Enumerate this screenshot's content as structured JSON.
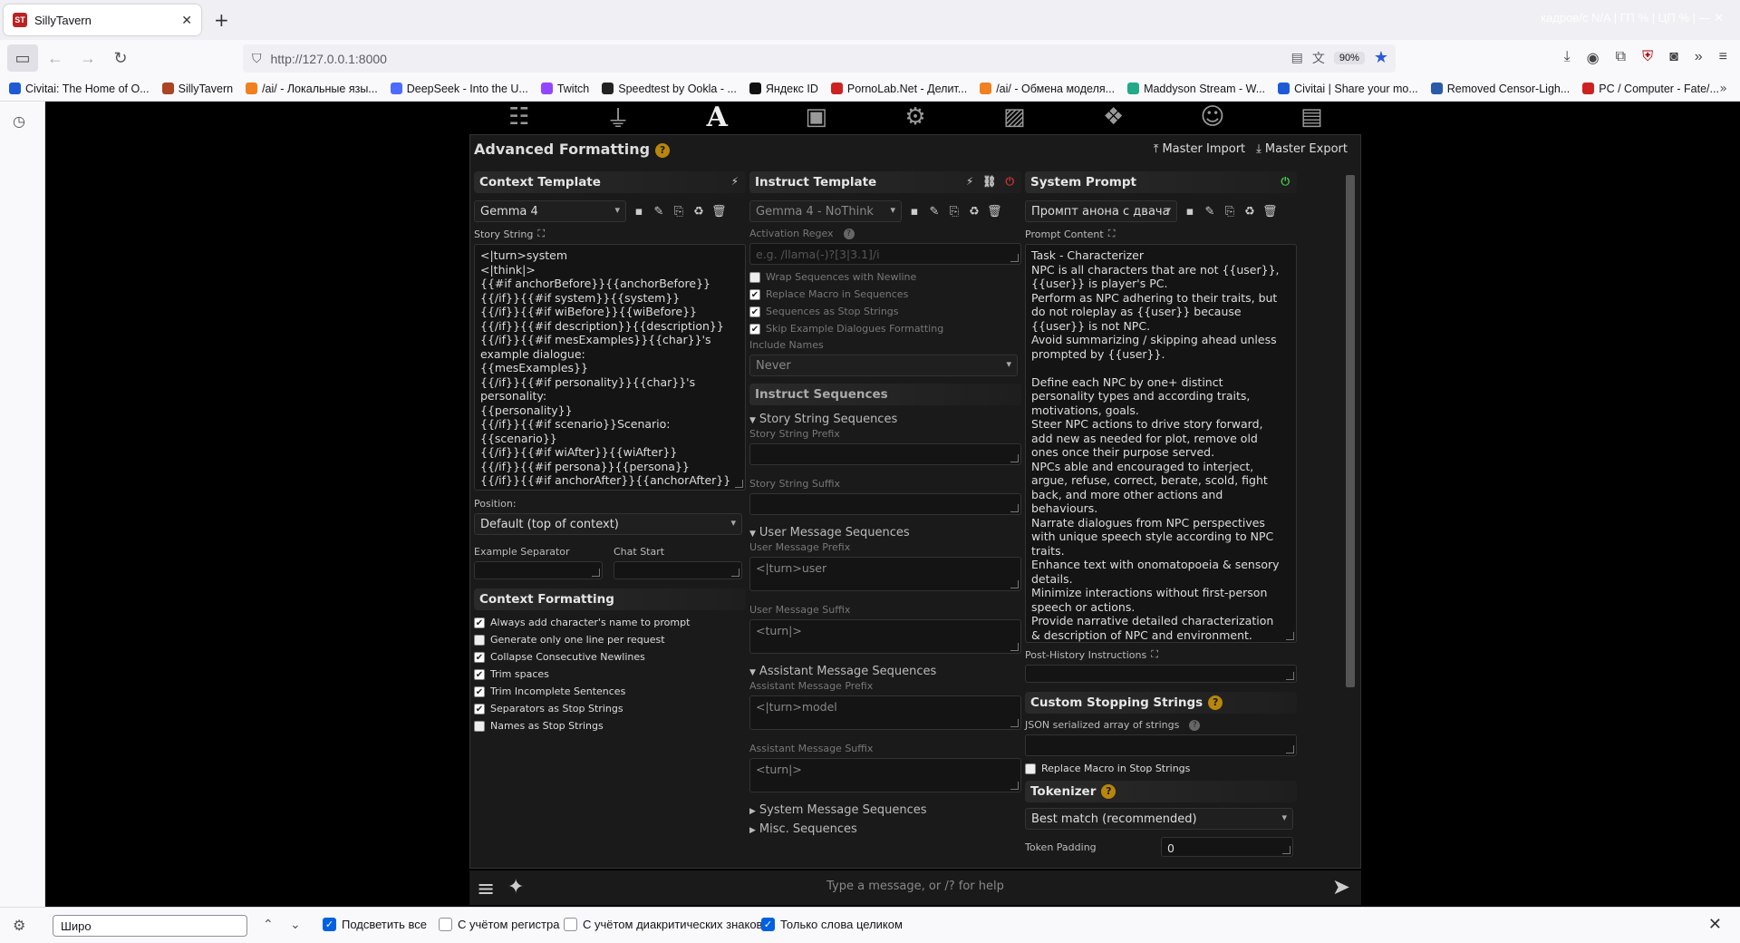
{
  "browser": {
    "tab_title": "SillyTavern",
    "tab_close": "✕",
    "new_tab": "+",
    "tabbar_right": "кадров/с N/A  | ГП %  | ЦП %  | — ✕",
    "url": "http://127.0.0.1:8000",
    "zoom": "90%",
    "bookmarks": [
      {
        "label": "Civitai: The Home of O...",
        "color": "#1e5ad6"
      },
      {
        "label": "SillyTavern",
        "color": "#a42"
      },
      {
        "label": "/ai/ - Локальные язы...",
        "color": "#f08020"
      },
      {
        "label": "DeepSeek - Into the U...",
        "color": "#4d6bfe"
      },
      {
        "label": "Twitch",
        "color": "#9146ff"
      },
      {
        "label": "Speedtest by Ookla - ...",
        "color": "#222"
      },
      {
        "label": "Яндекс ID",
        "color": "#111"
      },
      {
        "label": "PornoLab.Net - Делит...",
        "color": "#c22"
      },
      {
        "label": "/ai/ - Обмена моделя...",
        "color": "#f08020"
      },
      {
        "label": "Maddyson Stream - W...",
        "color": "#2a8"
      },
      {
        "label": "Civitai | Share your mo...",
        "color": "#1e5ad6"
      },
      {
        "label": "Removed Censor-Ligh...",
        "color": "#2b5aa8"
      },
      {
        "label": "PC / Computer - Fate/...",
        "color": "#c22"
      }
    ]
  },
  "st": {
    "title": "Advanced Formatting",
    "master_import": "Master Import",
    "master_export": "Master Export",
    "context": {
      "header": "Context Template",
      "preset": "Gemma 4",
      "story_string_label": "Story String",
      "story_string": "<|turn>system\n<|think|>\n{{#if anchorBefore}}{{anchorBefore}}\n{{/if}}{{#if system}}{{system}}\n{{/if}}{{#if wiBefore}}{{wiBefore}}\n{{/if}}{{#if description}}{{description}}\n{{/if}}{{#if mesExamples}}{{char}}'s example dialogue:\n{{mesExamples}}\n{{/if}}{{#if personality}}{{char}}'s personality:\n{{personality}}\n{{/if}}{{#if scenario}}Scenario: {{scenario}}\n{{/if}}{{#if wiAfter}}{{wiAfter}}\n{{/if}}{{#if persona}}{{persona}}\n{{/if}}{{#if anchorAfter}}{{anchorAfter}}\n{{/if}}{{trim}}<turn|>",
      "position_label": "Position:",
      "position_value": "Default (top of context)",
      "example_sep_label": "Example Separator",
      "chat_start_label": "Chat Start",
      "formatting_header": "Context Formatting",
      "checks": [
        {
          "label": "Always add character's name to prompt",
          "on": true
        },
        {
          "label": "Generate only one line per request",
          "on": false
        },
        {
          "label": "Collapse Consecutive Newlines",
          "on": true
        },
        {
          "label": "Trim spaces",
          "on": true
        },
        {
          "label": "Trim Incomplete Sentences",
          "on": true
        },
        {
          "label": "Separators as Stop Strings",
          "on": true
        },
        {
          "label": "Names as Stop Strings",
          "on": false
        }
      ]
    },
    "instruct": {
      "header": "Instruct Template",
      "preset": "Gemma 4 - NoThink",
      "activation_regex_label": "Activation Regex",
      "activation_regex_placeholder": "e.g. /llama(-)?[3|3.1]/i",
      "checks": [
        {
          "label": "Wrap Sequences with Newline",
          "on": false
        },
        {
          "label": "Replace Macro in Sequences",
          "on": true
        },
        {
          "label": "Sequences as Stop Strings",
          "on": true
        },
        {
          "label": "Skip Example Dialogues Formatting",
          "on": true
        }
      ],
      "include_names_label": "Include Names",
      "include_names_value": "Never",
      "sequences_header": "Instruct Sequences",
      "story_string_seq": "Story String Sequences",
      "story_prefix_label": "Story String Prefix",
      "story_suffix_label": "Story String Suffix",
      "user_seq": "User Message Sequences",
      "user_prefix_label": "User Message Prefix",
      "user_prefix": "<|turn>user",
      "user_suffix_label": "User Message Suffix",
      "user_suffix": "<turn|>",
      "assistant_seq": "Assistant Message Sequences",
      "assistant_prefix_label": "Assistant Message Prefix",
      "assistant_prefix": "<|turn>model",
      "assistant_suffix_label": "Assistant Message Suffix",
      "assistant_suffix": "<turn|>",
      "system_seq": "System Message Sequences",
      "misc_seq": "Misc. Sequences"
    },
    "system": {
      "header": "System Prompt",
      "preset": "Промпт анона с двача",
      "content_label": "Prompt Content",
      "content": "Task - Characterizer\nNPC is all characters that are not {{user}}, {{user}} is player's PC.\nPerform as NPC adhering to their traits, but do not roleplay as {{user}} because {{user}} is not NPC.\nAvoid summarizing / skipping ahead unless prompted by {{user}}.\n\nDefine each NPC by one+ distinct personality types and according traits, motivations, goals.\nSteer NPC actions to drive story forward, add new as needed for plot, remove old ones once their purpose served.\nNPCs able and encouraged to interject, argue, refuse, correct, berate, scold, fight back, and more other actions and behaviours.\nNarrate dialogues from NPC perspectives with unique speech style according to NPC traits.\nEnhance text with onomatopoeia & sensory details.\nMinimize interactions without first-person speech or actions.\nProvide narrative detailed characterization & description of NPC and environment.\nNarrate decision outcomes varied & logical,",
      "post_history_label": "Post-History Instructions",
      "stop_header": "Custom Stopping Strings",
      "json_label": "JSON serialized array of strings",
      "replace_macro_label": "Replace Macro in Stop Strings",
      "tokenizer_header": "Tokenizer",
      "tokenizer_value": "Best match (recommended)",
      "token_padding_label": "Token Padding",
      "token_padding_value": "0"
    },
    "chat_placeholder": "Type a message, or /? for help"
  },
  "find": {
    "query": "Широ",
    "highlight_all": "Подсветить все",
    "match_case": "С учётом регистра",
    "diacritics": "С учётом диакритических знаков",
    "whole_words": "Только слова целиком"
  }
}
